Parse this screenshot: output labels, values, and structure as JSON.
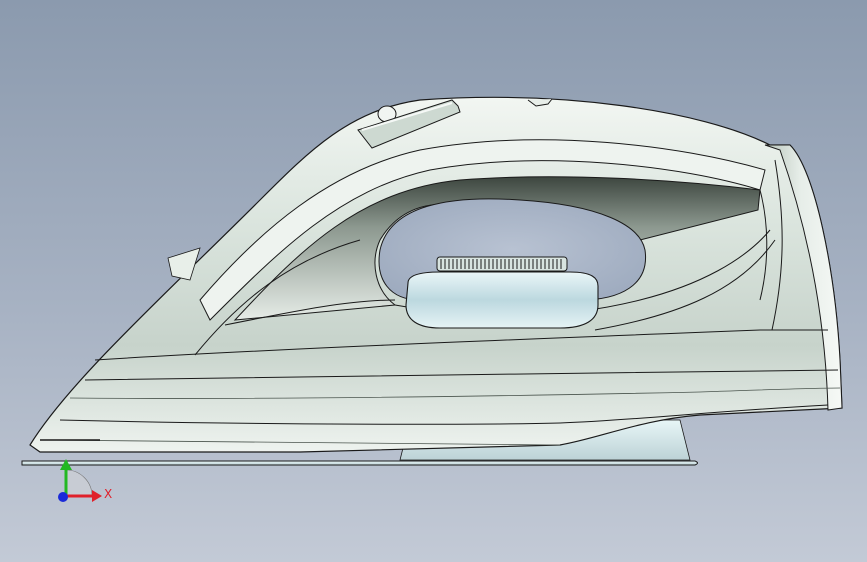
{
  "viewport": {
    "background_top": "#8b9aae",
    "background_bottom": "#c3cad6",
    "model_body_color": "#dfe7e1",
    "model_shadow_color": "#5f6b63",
    "soleplate_color": "#d9ecec",
    "dial_color": "#cfe6ea",
    "edge_color": "#1a1a1a"
  },
  "triad": {
    "x_axis_label": "X",
    "x_axis_color": "#e0202a",
    "y_axis_color": "#22b822",
    "z_axis_color": "#1a2ad8"
  }
}
